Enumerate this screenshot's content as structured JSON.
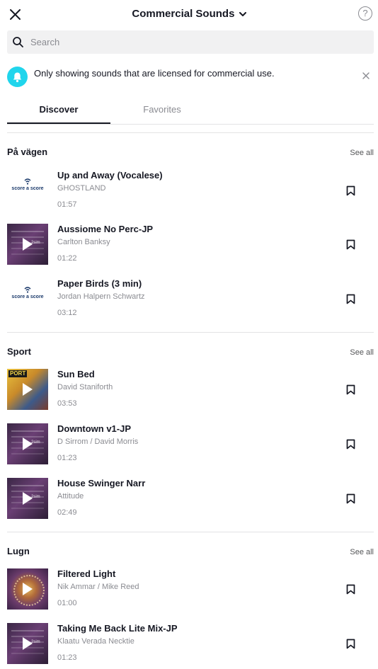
{
  "header": {
    "title": "Commercial Sounds",
    "help_label": "?"
  },
  "search": {
    "placeholder": "Search",
    "value": ""
  },
  "notice": {
    "text": "Only showing sounds that are licensed for commercial use."
  },
  "tabs": [
    {
      "label": "Discover",
      "active": true
    },
    {
      "label": "Favorites",
      "active": false
    }
  ],
  "sections": [
    {
      "title": "På vägen",
      "see_all": "See all",
      "tracks": [
        {
          "title": "Up and Away (Vocalese)",
          "artist": "GHOSTLAND",
          "duration": "01:57",
          "thumb": "score",
          "thumb_text": "score a score"
        },
        {
          "title": "Aussiome No Perc-JP",
          "artist": "Carlton Banksy",
          "duration": "01:22",
          "thumb": "purple",
          "thumb_text": "2sim"
        },
        {
          "title": "Paper Birds (3 min)",
          "artist": "Jordan Halpern Schwartz",
          "duration": "03:12",
          "thumb": "score",
          "thumb_text": "score a score"
        }
      ]
    },
    {
      "title": "Sport",
      "see_all": "See all",
      "tracks": [
        {
          "title": "Sun Bed",
          "artist": "David Staniforth",
          "duration": "03:53",
          "thumb": "sun",
          "thumb_text": "PORT"
        },
        {
          "title": "Downtown v1-JP",
          "artist": "D Sirrom / David Morris",
          "duration": "01:23",
          "thumb": "purple",
          "thumb_text": "2sim"
        },
        {
          "title": "House Swinger Narr",
          "artist": "Attitude",
          "duration": "02:49",
          "thumb": "purple",
          "thumb_text": "2sim"
        }
      ]
    },
    {
      "title": "Lugn",
      "see_all": "See all",
      "tracks": [
        {
          "title": "Filtered Light",
          "artist": "Nik Ammar / Mike Reed",
          "duration": "01:00",
          "thumb": "mandala",
          "thumb_text": ""
        },
        {
          "title": "Taking Me Back Lite Mix-JP",
          "artist": "Klaatu Verada Necktie",
          "duration": "01:23",
          "thumb": "purple",
          "thumb_text": "2sim"
        }
      ]
    }
  ]
}
